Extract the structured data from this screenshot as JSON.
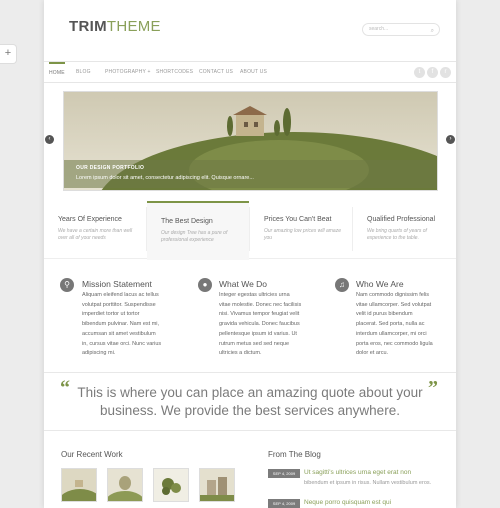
{
  "logo": {
    "part1": "TRIM",
    "part2": "THEME"
  },
  "search": {
    "placeholder": "search..."
  },
  "nav": [
    {
      "label": "Home"
    },
    {
      "label": "Blog"
    },
    {
      "label": "Photography +"
    },
    {
      "label": "Shortcodes"
    },
    {
      "label": "Contact Us"
    },
    {
      "label": "About Us"
    }
  ],
  "hero": {
    "title": "OUR DESIGN PORTFOLIO",
    "text": "Lorem ipsum dolor sit amet, consectetur adipiscing elit. Quisque ornare..."
  },
  "tabs": [
    {
      "title": "Years Of Experience",
      "sub": "We have a certain more than well over all of your needs"
    },
    {
      "title": "The Best Design",
      "sub": "Our design Tree has a pure of professional experience"
    },
    {
      "title": "Prices You Can't Beat",
      "sub": "Our amazing low prices will amaze you"
    },
    {
      "title": "Qualified Professional",
      "sub": "We bring quarts of years of experience to the table."
    }
  ],
  "services": [
    {
      "icon": "search-icon",
      "glyph": "⚲",
      "title": "Mission Statement",
      "lines": [
        "Aliquam eleifend lacus ac tellus",
        "volutpat porttitor. Suspendisse",
        "imperdiet tortor ut tortor",
        "bibendum pulvinar. Nam est mi,",
        "accumsan sit amet vestibulum",
        "in, cursus vitae orci. Nunc varius",
        "adipiscing mi."
      ]
    },
    {
      "icon": "chat-icon",
      "glyph": "●",
      "title": "What We Do",
      "lines": [
        "Integer egestas ultricies urna",
        "vitae molestie. Donec nec facilisis",
        "nisi. Vivamus tempor feugiat velit",
        "gravida vehicula. Donec faucibus",
        "pellentesque ipsum id varius. Ut",
        "rutrum metus sed sed neque",
        "ultricies a dictum."
      ]
    },
    {
      "icon": "music-icon",
      "glyph": "♫",
      "title": "Who We Are",
      "lines": [
        "Nam commodo dignissim felis",
        "vitae ullamcorper. Sed volutpat",
        "velit id purus bibendum",
        "placerat. Sed porta, nulla ac",
        "interdum ullamcorper, mi orci",
        "porta eros, nec commodo ligula",
        "dolor et arcu."
      ]
    }
  ],
  "quote": "This is where you can place an amazing quote about your business. We provide the best services anywhere.",
  "recent_work": {
    "title": "Our Recent Work"
  },
  "blog": {
    "title": "From The Blog",
    "posts": [
      {
        "date": "SEP 4, 2009",
        "title": "Ut sagitti's ultrices urna eget erat non",
        "excerpt": "bibendum et ipsum in risus. Nullam vestibulum eros."
      },
      {
        "date": "SEP 4, 2009",
        "title": "Neque porro quisquam est qui",
        "excerpt": ""
      }
    ]
  },
  "colors": {
    "accent": "#7d9447",
    "hero_sky": "#d6d2bd",
    "hill": "#6b7a3a"
  }
}
